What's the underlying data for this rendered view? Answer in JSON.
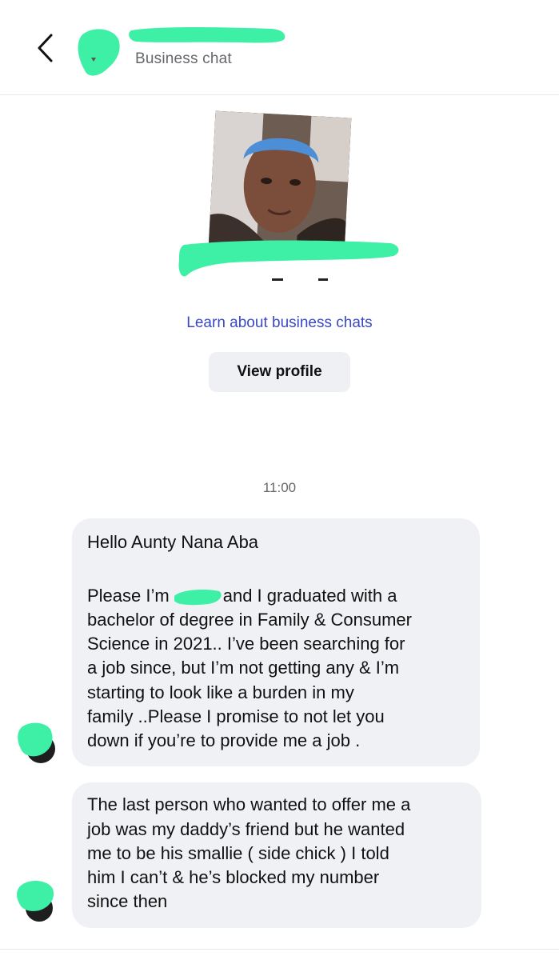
{
  "header": {
    "back_icon": "chevron-left-icon",
    "subtitle": "Business chat"
  },
  "profile": {
    "learn_link": "Learn about business chats",
    "view_profile_label": "View profile"
  },
  "chat": {
    "timestamp": "11:00",
    "messages": [
      {
        "lines": [
          "Hello Aunty Nana Aba",
          "",
          "Please I’m",
          "and I graduated with a",
          "bachelor of degree in Family & Consumer",
          "Science in 2021.. I’ve been searching for",
          "a job since, but I’m not getting any & I’m",
          "starting to look like a burden in my",
          "family ..Please I promise to not let you",
          "down if you’re to provide me a job ."
        ]
      },
      {
        "lines": [
          "The last person who wanted to offer me a",
          "job was my daddy’s friend but he wanted",
          "me to be his smallie ( side chick ) I told",
          "him I can’t & he’s blocked my number",
          "since then"
        ]
      }
    ]
  },
  "colors": {
    "redaction": "#3ef0a6",
    "link": "#3a48c8",
    "bubble": "#f0f1f4",
    "secondary_text": "#65676b"
  }
}
